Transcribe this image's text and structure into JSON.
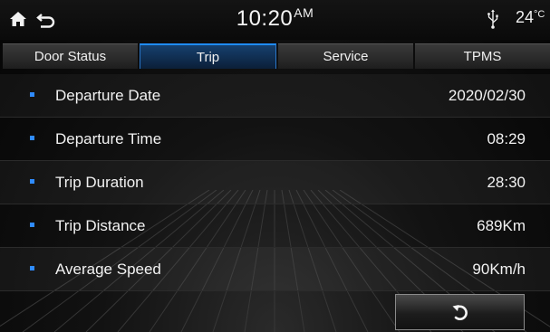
{
  "status_bar": {
    "time": "10:20",
    "ampm": "AM",
    "temperature": "24",
    "temperature_unit": "°C",
    "icons": [
      "home-icon",
      "back-icon",
      "usb-icon"
    ]
  },
  "tabs": [
    {
      "label": "Door Status",
      "active": false
    },
    {
      "label": "Trip",
      "active": true
    },
    {
      "label": "Service",
      "active": false
    },
    {
      "label": "TPMS",
      "active": false
    }
  ],
  "trip_info": [
    {
      "label": "Departure Date",
      "value": "2020/02/30"
    },
    {
      "label": "Departure Time",
      "value": "08:29"
    },
    {
      "label": "Trip Duration",
      "value": "28:30"
    },
    {
      "label": "Trip Distance",
      "value": "689Km"
    },
    {
      "label": "Average Speed",
      "value": "90Km/h"
    }
  ],
  "footer": {
    "button_icon": "refresh-icon"
  },
  "colors": {
    "accent": "#1f8cff",
    "bullet": "#2f8bff",
    "active_tab_bg": "#16406e"
  }
}
